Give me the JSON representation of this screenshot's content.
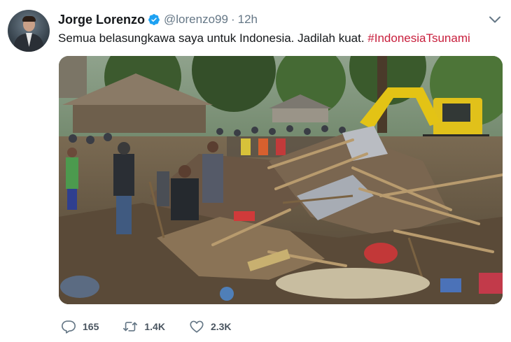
{
  "author": {
    "name": "Jorge Lorenzo",
    "handle": "@lorenzo99",
    "separator": "·",
    "time": "12h",
    "verified": true
  },
  "tweet": {
    "text": "Semua belasungkawa saya untuk Indonesia. Jadilah kuat. ",
    "hashtag": "#IndonesiaTsunami"
  },
  "actions": {
    "replies": "165",
    "retweets": "1.4K",
    "likes": "2.3K"
  },
  "icons": {
    "verified": "verified-badge-icon",
    "caret": "chevron-down-icon",
    "reply": "reply-icon",
    "retweet": "retweet-icon",
    "like": "heart-icon"
  },
  "colors": {
    "hashtag": "#c81e3c",
    "verified": "#1da1f2",
    "secondary_text": "#657786"
  }
}
